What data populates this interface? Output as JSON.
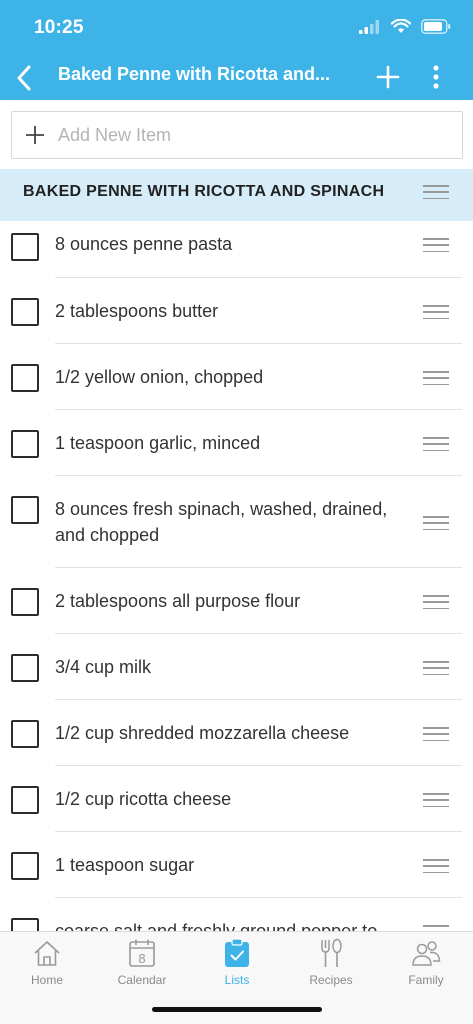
{
  "status": {
    "time": "10:25"
  },
  "nav": {
    "title": "Baked Penne with Ricotta and..."
  },
  "add": {
    "placeholder": "Add New Item"
  },
  "section": {
    "title": "BAKED PENNE WITH RICOTTA AND SPINACH"
  },
  "items": [
    {
      "label": "8 ounces penne pasta"
    },
    {
      "label": "2 tablespoons butter"
    },
    {
      "label": "1/2 yellow onion, chopped"
    },
    {
      "label": "1 teaspoon garlic, minced"
    },
    {
      "label": "8 ounces fresh spinach, washed, drained, and chopped"
    },
    {
      "label": "2 tablespoons all purpose flour"
    },
    {
      "label": "3/4 cup milk"
    },
    {
      "label": "1/2 cup shredded mozzarella cheese"
    },
    {
      "label": "1/2 cup ricotta cheese"
    },
    {
      "label": "1 teaspoon sugar"
    },
    {
      "label": "coarse salt and freshly ground pepper to"
    }
  ],
  "tabs": [
    {
      "label": "Home",
      "icon": "home-icon"
    },
    {
      "label": "Calendar",
      "icon": "calendar-icon",
      "badge": "8"
    },
    {
      "label": "Lists",
      "icon": "lists-icon"
    },
    {
      "label": "Recipes",
      "icon": "recipes-icon"
    },
    {
      "label": "Family",
      "icon": "family-icon"
    }
  ],
  "colors": {
    "accent": "#3db3e8",
    "section_bg": "#d6ecf8"
  }
}
